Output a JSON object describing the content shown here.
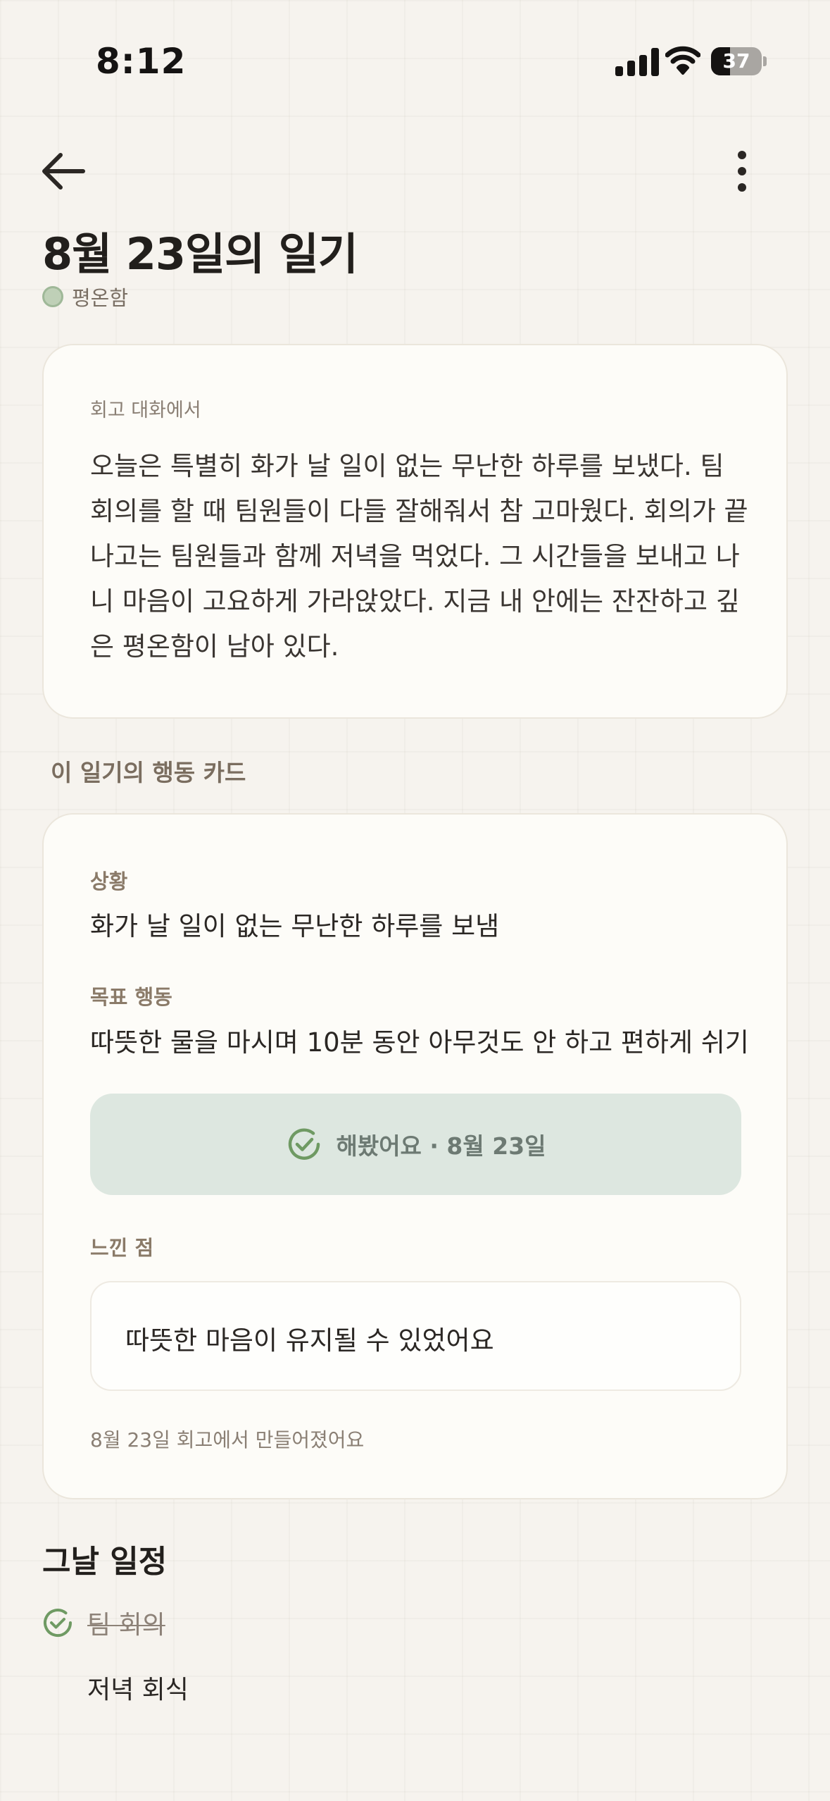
{
  "status_bar": {
    "time": "8:12",
    "battery_percent": "37",
    "battery_level": 0.37
  },
  "header": {
    "title": "8월 23일의 일기",
    "mood": "평온함"
  },
  "diary": {
    "source": "회고 대화에서",
    "body": "오늘은 특별히 화가 날 일이 없는 무난한 하루를 보냈다. 팀 회의를 할 때 팀원들이 다들 잘해줘서 참 고마웠다. 회의가 끝나고는 팀원들과 함께 저녁을 먹었다. 그 시간들을 보내고 나니 마음이 고요하게 가라앉았다. 지금 내 안에는 잔잔하고 깊은 평온함이 남아 있다."
  },
  "action_section_label": "이 일기의 행동 카드",
  "action_card": {
    "situation_label": "상황",
    "situation": "화가 날 일이 없는 무난한 하루를 보냄",
    "goal_label": "목표 행동",
    "goal": "따뜻한 물을 마시며 10분 동안 아무것도 안 하고 편하게 쉬기",
    "done_label": "해봤어요 · 8월 23일",
    "reflection_label": "느낀 점",
    "reflection": "따뜻한 마음이 유지될 수 있었어요",
    "footnote": "8월 23일 회고에서 만들어졌어요"
  },
  "schedule": {
    "title": "그날 일정",
    "items": [
      {
        "label": "팀 회의",
        "done": true
      },
      {
        "label": "저녁 회식",
        "done": false
      }
    ]
  },
  "icons": {
    "back": "arrow-left-icon",
    "more": "more-vertical-icon",
    "check": "check-circle-icon"
  },
  "colors": {
    "background": "#f6f3ee",
    "accent_green": "#6f9a63",
    "done_button_bg": "#dde7e0",
    "mood_dot": "#bfd0b7"
  }
}
